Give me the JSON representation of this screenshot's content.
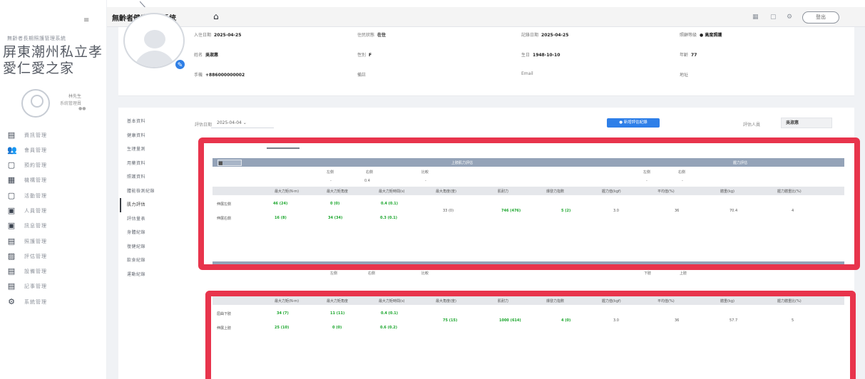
{
  "sidebar": {
    "subtitle": "無齡者長期照護管理系統",
    "org_name": "屏東潮州私立孝愛仁愛之家",
    "user_name": "林先生",
    "user_role": "系統管理員",
    "user_status": "●●",
    "items": [
      {
        "label": "資訊管理",
        "icon": "▤"
      },
      {
        "label": "會員管理",
        "icon": "👥"
      },
      {
        "label": "預約管理",
        "icon": "▢"
      },
      {
        "label": "機構管理",
        "icon": "▦"
      },
      {
        "label": "活動管理",
        "icon": "▢"
      },
      {
        "label": "人員管理",
        "icon": "▣"
      },
      {
        "label": "訊息管理",
        "icon": "▣"
      },
      {
        "label": "照護管理",
        "icon": "▤"
      },
      {
        "label": "評估管理",
        "icon": "▨"
      },
      {
        "label": "設備管理",
        "icon": "▤"
      },
      {
        "label": "記事管理",
        "icon": "▤"
      },
      {
        "label": "系統管理",
        "icon": "⚙"
      }
    ]
  },
  "topbar": {
    "title": "無齡者健康管理系統",
    "action_button": "登出"
  },
  "profile": {
    "admit_date_label": "入住日期",
    "admit_date": "2025-04-25",
    "status_label": "住民狀態",
    "status": "在住",
    "record_date_label": "記錄日期",
    "record_date": "2025-04-25",
    "care_level_label": "照顧等級",
    "care_level": "● 高度照護",
    "name_label": "姓名",
    "name": "吳淑惠",
    "gender_label": "性別",
    "gender": "F",
    "birth_label": "生日",
    "birth": "1948-10-10",
    "age_label": "年齡",
    "age": "77",
    "phone_label": "手機",
    "phone": "+886000000002",
    "note_label": "備註",
    "note": "",
    "email_label": "Email",
    "email": "",
    "address_label": "地址",
    "address": ""
  },
  "subnav": {
    "items": [
      "基本資料",
      "健康資料",
      "生理量測",
      "用藥資料",
      "照護資料",
      "體能檢測紀錄",
      "肌力評估",
      "評估量表",
      "身體紀錄",
      "復健紀錄",
      "飲食紀錄",
      "運動紀錄"
    ],
    "active_index": 6
  },
  "toolbar": {
    "date_label": "評估日期",
    "date_value": "2025-04-04 ⌄",
    "primary_button": "● 新增評估紀錄",
    "evaluator_label": "評估人員",
    "evaluator_value": "吳淑惠"
  },
  "upper_section": {
    "band_tag": "■",
    "band_left": "上肢肌力評估",
    "band_right": "握力評估",
    "subhdr": [
      "左側",
      "右側",
      "比較",
      "左側",
      "右側"
    ],
    "subval": [
      "-",
      "0.4",
      "-",
      "-",
      "-"
    ],
    "columns": [
      "最大力矩(N·m)",
      "最大力矩角度",
      "最大力矩時間(s)",
      "最大角度(度)",
      "肌耐力",
      "爆發力指數",
      "握力值(kgf)",
      "平均值(%)",
      "體重(kg)",
      "握力體重比(%)"
    ],
    "rows": [
      {
        "label": "伸展左側",
        "c1": "46 (24)",
        "c2": "0 (0)",
        "c3": "0.4 (0.1)"
      },
      {
        "label": "伸展右側",
        "c1": "16 (8)",
        "c2": "34 (34)",
        "c3": "0.3 (0.1)"
      }
    ],
    "shared": {
      "angle": "33 (0)",
      "endurance": "746 (476)",
      "power": "5 (2)",
      "grip": "3.0",
      "avg": "36",
      "weight": "70.4",
      "ratio": "4"
    }
  },
  "lower_section": {
    "subhdr": [
      "左側",
      "右側",
      "比較",
      "下肢",
      "上肢"
    ],
    "columns": [
      "最大力矩(N·m)",
      "最大力矩角度",
      "最大力矩時間(s)",
      "最大角度(度)",
      "肌耐力",
      "爆發力指數",
      "握力值(kgf)",
      "平均值(%)",
      "體重(kg)",
      "握力體重比(%)"
    ],
    "rows": [
      {
        "label": "屈曲下肢",
        "c1": "34 (7)",
        "c2": "11 (11)",
        "c3": "0.4 (0.1)"
      },
      {
        "label": "伸展上肢",
        "c1": "25 (10)",
        "c2": "0 (0)",
        "c3": "0.6 (0.2)"
      }
    ],
    "shared": {
      "angle": "75 (15)",
      "endurance": "1000 (614)",
      "power": "4 (0)",
      "grip": "3.0",
      "avg": "36",
      "weight": "57.7",
      "ratio": "5"
    }
  }
}
